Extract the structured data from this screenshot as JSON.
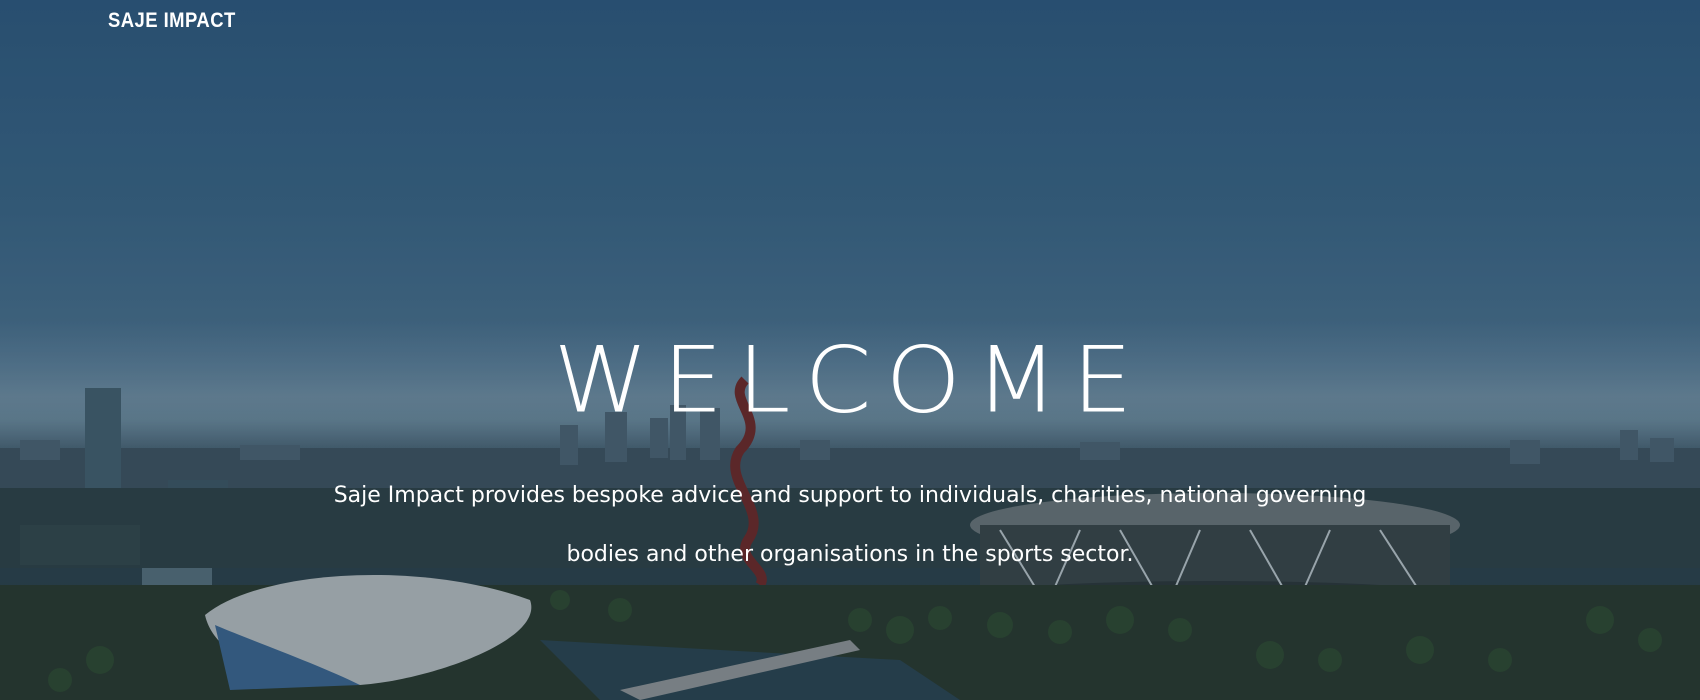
{
  "brand": {
    "name": "SAJE IMPACT",
    "accent_color": "#4caf50"
  },
  "hero": {
    "heading": "WELCOME",
    "description": "Saje Impact provides bespoke advice and support to individuals, charities, national governing bodies and other organisations in the sports sector."
  }
}
